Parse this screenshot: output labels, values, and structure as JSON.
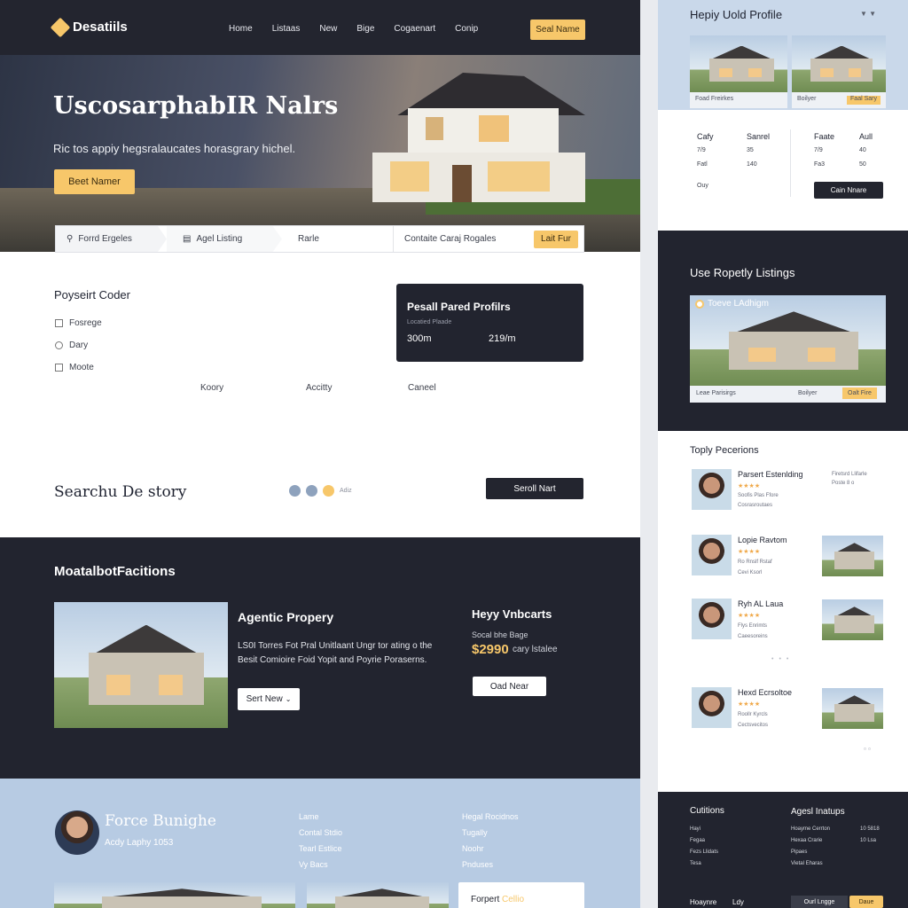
{
  "brand": "Desatiils",
  "nav": [
    "Home",
    "Listaas",
    "New",
    "Bige",
    "Cogaenart",
    "Conip"
  ],
  "nav_cta": "Seal Name",
  "hero": {
    "title": "UscosarphabIR Nalrs",
    "subtitle": "Ric tos appiy hegsralaucates horasgrary hichel.",
    "cta": "Beet Namer"
  },
  "searchbar": {
    "items": [
      "Forrd Ergeles",
      "Agel Listing",
      "Rarle",
      "Contaite Caraj Rogales"
    ],
    "button": "Lait Fur"
  },
  "property_cooler": {
    "title": "Poyseirt Coder",
    "items": [
      "Fosrege",
      "Dary",
      "Moote"
    ],
    "columns": [
      "Koory",
      "Accitty",
      "Caneel"
    ]
  },
  "profile_card": {
    "title": "Pesall Pared Profilrs",
    "sub": "Locatied Plaade",
    "stat1": "300m",
    "stat2": "219/m"
  },
  "search_story": {
    "title": "Searchu De story",
    "link": "Adiz",
    "button": "Seroll Nart"
  },
  "featured": {
    "section_title": "MoatalbotFacitions",
    "title": "Agentic Propery",
    "desc_line1": "LS0I Torres Fot Pral Unitlaant Ungr tor ating o the",
    "desc_line2": "Besit Comioire Foid Yopit and Poyrie Poraserns.",
    "button": "Sert New",
    "side_title": "Heyy Vnbcarts",
    "side_sub": "Socal bhe Bage",
    "price": "$2990",
    "price_note": "cary lstalee",
    "side_button": "Oad Near"
  },
  "agent": {
    "name": "Force Bunighe",
    "sub": "Acdy Laphy 1053",
    "col1": [
      "Lame",
      "Contal Stdio",
      "Tearl Estlice",
      "Vy Bacs"
    ],
    "col2": [
      "Hegal Rocidnos",
      "Tugally",
      "Noohr",
      "Pnduses"
    ],
    "card_label": "Forpert",
    "card_accent": "Cellio"
  },
  "rp_profile": {
    "title": "Hepiy Uold Profile",
    "img1_label": "Foad Freirkes",
    "img2_label": "Boilyer",
    "img2_tag": "Faal Sary",
    "cols": [
      {
        "head": "Cafy",
        "rows": [
          "7/9",
          "Fatl",
          "Ouy"
        ]
      },
      {
        "head": "Sanrel",
        "rows": [
          "35",
          "140"
        ]
      },
      {
        "head": "Faate",
        "rows": [
          "7/9",
          "Fa3"
        ]
      },
      {
        "head": "Aull",
        "rows": [
          "40",
          "50"
        ]
      }
    ],
    "button": "Cain Nnare"
  },
  "rp_listings": {
    "title": "Use Ropetly Listings",
    "banner": "Toeve LAdhigm",
    "label": "Leae Parisirgs",
    "label2": "Boilyer",
    "tag": "Oalt Fire"
  },
  "rp_reviews": {
    "title": "Toply Pecerions",
    "items": [
      {
        "name": "Parsert Estenlding",
        "meta": "Firetsrd Llifarle",
        "meta2": "Poste 8 o",
        "l1": "Soofis Plas Ffore",
        "l2": "Cosrasroutaes"
      },
      {
        "name": "Lopie Ravtom",
        "meta": "",
        "meta2": "",
        "l1": "Ro Rnslf Rstaf",
        "l2": "Cevi Ksorl"
      },
      {
        "name": "Ryh AL Laua",
        "meta": "",
        "meta2": "",
        "l1": "Flys Enrimts",
        "l2": "Caeesoreins"
      },
      {
        "name": "Hexd Ecrsoltoe",
        "meta": "",
        "meta2": "",
        "l1": "Roollr Kyrcls",
        "l2": "Cectsvecitos"
      }
    ]
  },
  "rp_footer": {
    "col1_title": "Cutitions",
    "col1": [
      "Hayi",
      "Fegaa",
      "Fezs Llidats",
      "Tesa"
    ],
    "col2_title": "Agesl Inatups",
    "col2": [
      "Hoayme Cerrton",
      "Hexaa Crarie",
      "Pipaes",
      "Vietal Eharas"
    ],
    "col3": [
      "10 5818",
      "10 Lsa"
    ],
    "links": [
      "Hoaynre",
      "Ldy"
    ],
    "cta_dark": "Ourl Lngge",
    "cta_yellow": "Daue"
  },
  "colors": {
    "accent": "#f7c76a",
    "dark": "#22242f",
    "light_blue": "#b7cbe3"
  }
}
